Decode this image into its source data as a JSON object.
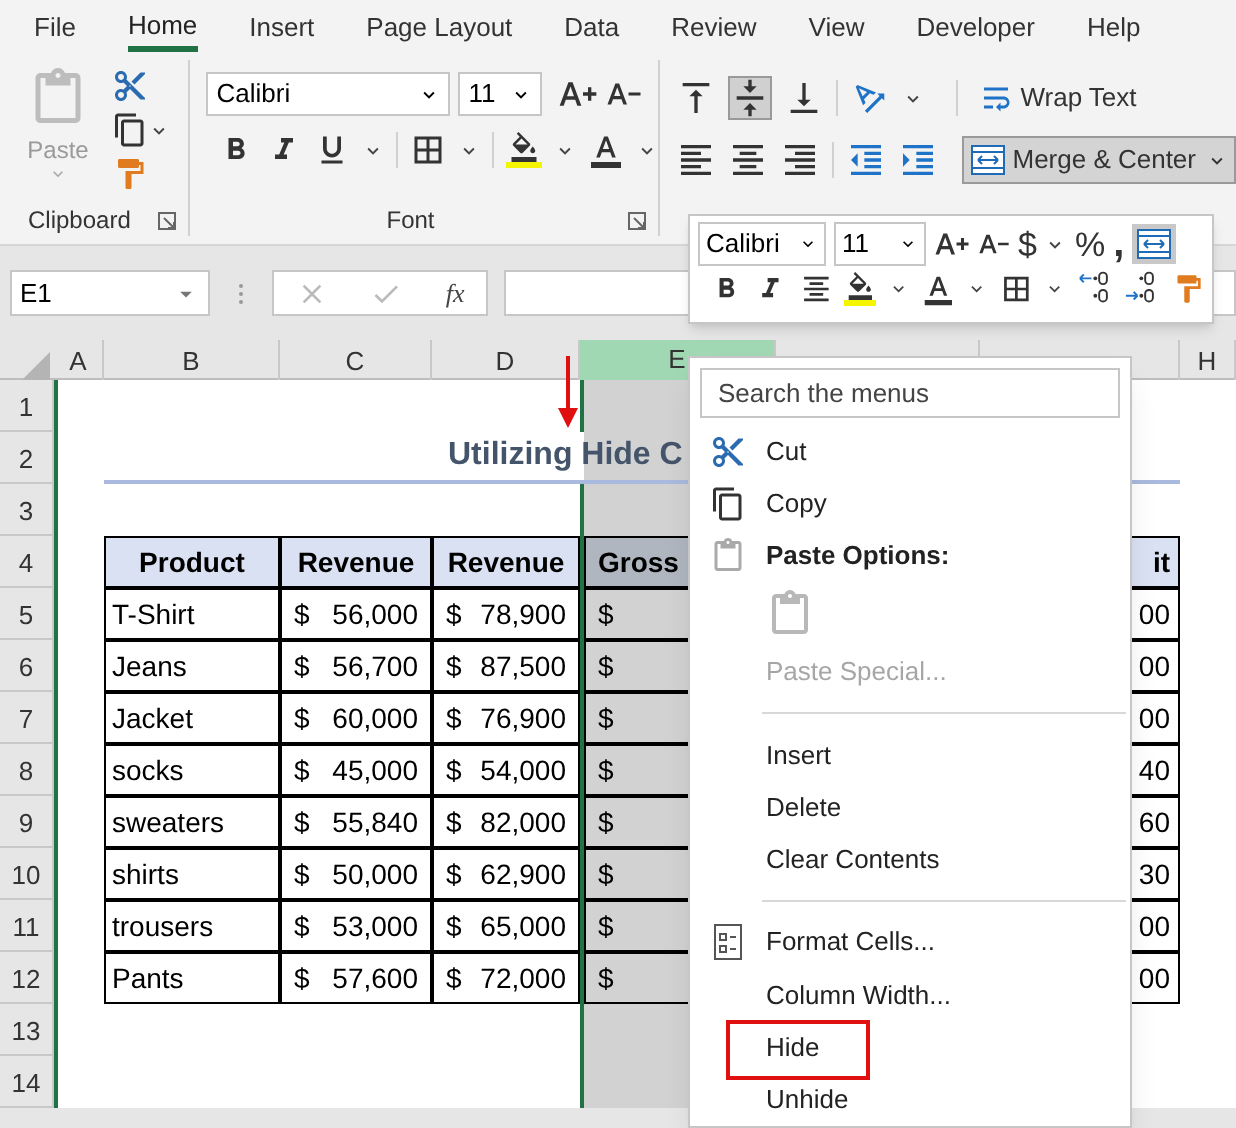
{
  "menu_tabs": [
    {
      "label": "File",
      "selected": false
    },
    {
      "label": "Home",
      "selected": true
    },
    {
      "label": "Insert",
      "selected": false
    },
    {
      "label": "Page Layout",
      "selected": false
    },
    {
      "label": "Data",
      "selected": false
    },
    {
      "label": "Review",
      "selected": false
    },
    {
      "label": "View",
      "selected": false
    },
    {
      "label": "Developer",
      "selected": false
    },
    {
      "label": "Help",
      "selected": false
    }
  ],
  "ribbon": {
    "clipboard": {
      "paste": "Paste",
      "label": "Clipboard"
    },
    "font": {
      "name": "Calibri",
      "size": "11",
      "label": "Font"
    },
    "alignment": {
      "wrap_text": "Wrap Text",
      "merge_center": "Merge & Center"
    }
  },
  "name_box": "E1",
  "function_label": "fx",
  "column_headers": [
    {
      "label": "A",
      "selected": false
    },
    {
      "label": "B",
      "selected": false
    },
    {
      "label": "C",
      "selected": false
    },
    {
      "label": "D",
      "selected": false
    },
    {
      "label": "E",
      "selected": true
    },
    {
      "label": "H",
      "selected": false
    }
  ],
  "row_numbers": [
    "1",
    "2",
    "3",
    "4",
    "5",
    "6",
    "7",
    "8",
    "9",
    "10",
    "11",
    "12",
    "13",
    "14"
  ],
  "sheet": {
    "title": "Utilizing Hide C",
    "headers": [
      "Product",
      "Revenue",
      "Revenue",
      "Gross",
      "it"
    ],
    "rows": [
      {
        "cells": [
          "T-Shirt",
          "$",
          "56,000",
          "$",
          "78,900",
          "$",
          "00"
        ]
      },
      {
        "cells": [
          "Jeans",
          "$",
          "56,700",
          "$",
          "87,500",
          "$",
          "00"
        ]
      },
      {
        "cells": [
          "Jacket",
          "$",
          "60,000",
          "$",
          "76,900",
          "$",
          "00"
        ]
      },
      {
        "cells": [
          "socks",
          "$",
          "45,000",
          "$",
          "54,000",
          "$",
          "40"
        ]
      },
      {
        "cells": [
          "sweaters",
          "$",
          "55,840",
          "$",
          "82,000",
          "$",
          "60"
        ]
      },
      {
        "cells": [
          "shirts",
          "$",
          "50,000",
          "$",
          "62,900",
          "$",
          "30"
        ]
      },
      {
        "cells": [
          "trousers",
          "$",
          "53,000",
          "$",
          "65,000",
          "$",
          "00"
        ]
      },
      {
        "cells": [
          "Pants",
          "$",
          "57,600",
          "$",
          "72,000",
          "$",
          "00"
        ]
      }
    ]
  },
  "mini_toolbar": {
    "font": "Calibri",
    "size": "11",
    "currency": "$",
    "percent": "%",
    "comma": ","
  },
  "context_menu": {
    "search_placeholder": "Search the menus",
    "items": [
      {
        "kind": "cut",
        "label": "Cut",
        "disabled": false,
        "marked": false
      },
      {
        "kind": "copy",
        "label": "Copy",
        "disabled": false,
        "marked": false
      },
      {
        "kind": "header",
        "label": "Paste Options:"
      },
      {
        "kind": "paste_icons"
      },
      {
        "kind": "item",
        "label": "Paste Special...",
        "disabled": true,
        "marked": false
      },
      {
        "kind": "separator"
      },
      {
        "kind": "item",
        "label": "Insert",
        "disabled": false,
        "marked": false
      },
      {
        "kind": "item",
        "label": "Delete",
        "disabled": false,
        "marked": false
      },
      {
        "kind": "item",
        "label": "Clear Contents",
        "disabled": false,
        "marked": false
      },
      {
        "kind": "separator"
      },
      {
        "kind": "format",
        "label": "Format Cells...",
        "disabled": false,
        "marked": false
      },
      {
        "kind": "item",
        "label": "Column Width...",
        "disabled": false,
        "marked": false
      },
      {
        "kind": "item",
        "label": "Hide",
        "disabled": false,
        "marked": true
      },
      {
        "kind": "item",
        "label": "Unhide",
        "disabled": false,
        "marked": false
      }
    ]
  }
}
